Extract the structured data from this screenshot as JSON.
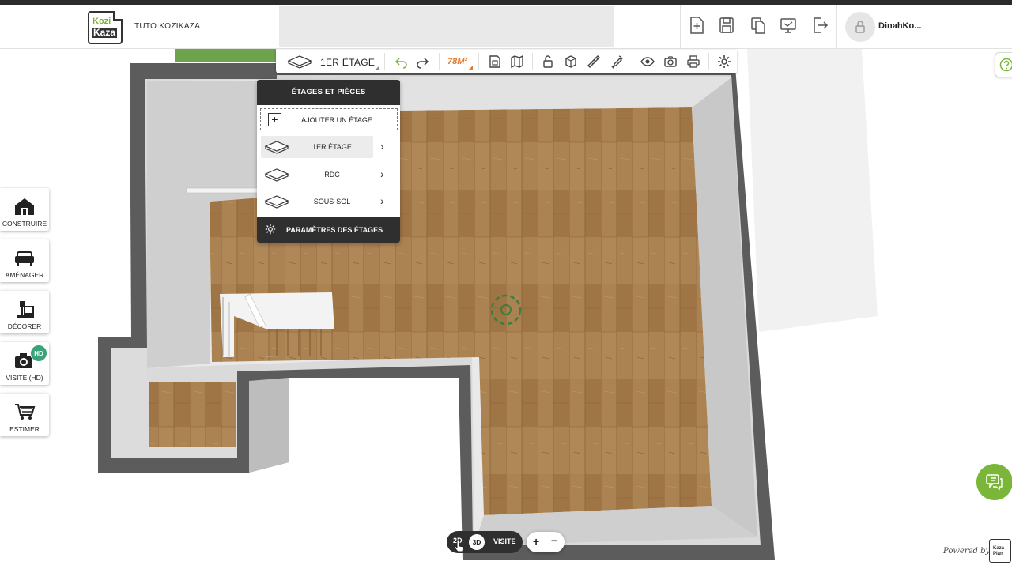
{
  "header": {
    "logo_line1": "Kozi",
    "logo_line2": "Kaza",
    "project_name": "TUTO KOZIKAZA",
    "username": "DinahKo...",
    "actions": [
      "new-file-icon",
      "save-icon",
      "copy-icon",
      "screen-icon",
      "logout-icon"
    ]
  },
  "toolbar": {
    "floor_label": "1ER ÉTAGE",
    "area": "78M²",
    "accent_color": "#e07a2e"
  },
  "floor_menu": {
    "title": "ÉTAGES ET PIÈCES",
    "add_label": "AJOUTER UN ÉTAGE",
    "add_symbol": "+",
    "items": [
      {
        "label": "1ER ÉTAGE",
        "selected": true
      },
      {
        "label": "RDC",
        "selected": false
      },
      {
        "label": "SOUS-SOL",
        "selected": false
      }
    ],
    "chevron": "›",
    "settings_label": "PARAMÈTRES DES ÉTAGES"
  },
  "sidebar": {
    "items": [
      {
        "label": "CONSTRUIRE",
        "icon": "house-icon"
      },
      {
        "label": "AMÉNAGER",
        "icon": "sofa-icon"
      },
      {
        "label": "DÉCORER",
        "icon": "lamp-icon"
      },
      {
        "label": "VISITE (HD)",
        "icon": "camera-icon"
      },
      {
        "label": "ESTIMER",
        "icon": "cart-icon"
      }
    ],
    "hd_badge": "HD",
    "hd_badge_color": "#3aa37a"
  },
  "view_modes": {
    "mode_2d": "2D",
    "mode_3d": "3D",
    "mode_visite": "VISITE",
    "active": "3D"
  },
  "zoom": {
    "plus": "+",
    "minus": "−"
  },
  "footer": {
    "powered_by": "Powered by",
    "powered_logo": "Kaza Plan"
  },
  "colors": {
    "brand_green": "#7ab638",
    "menu_dark": "#2f2f2f",
    "wall": "#5a5a5a",
    "floor_wood": "#a9804f"
  }
}
